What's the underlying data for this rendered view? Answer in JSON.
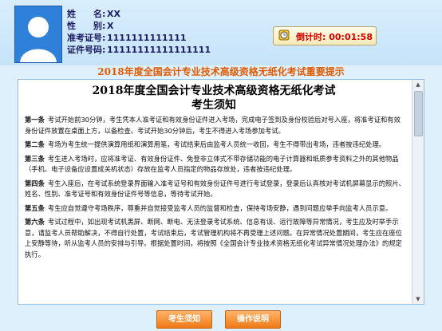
{
  "candidate": {
    "name_label": "姓　　名:",
    "name": "XX",
    "gender_label": "性　　别:",
    "gender": "X",
    "exam_no_label": "准考证号:",
    "exam_no": "1111111111111",
    "id_label": "证件号码:",
    "id_no": "11111111111111111"
  },
  "timer": {
    "label": "倒计时:",
    "value": "00:01:58",
    "icon": "clock-icon",
    "color": "#d10000"
  },
  "banner": "2018年度全国会计专业技术高级资格无纸化考试重要提示",
  "document": {
    "title": "2018年度全国会计专业技术高级资格无纸化考试",
    "subtitle": "考生须知",
    "articles": [
      {
        "label": "第一条",
        "text": "考试开始前30分钟，考生凭本人准考证和有效身份证件进入考场，完成电子签到及身份校验后对号入座，将准考证和有效身份证件放置在桌面上方，以备检查。考试开始30分钟后，考生不得进入考场参加考试。"
      },
      {
        "label": "第二条",
        "text": "考场为考生统一提供演算用纸和演算用笔，考试结束后由监考人员统一收回，考生不得带出考场，违者按违纪处理。"
      },
      {
        "label": "第三条",
        "text": "考生进入考场时，应将准考证、有效身份证件、免登非立体式不带存储功能的电子计算器和纸质参考资料之外的其他物品（手机、电子设备应设置成关机状态）存放在监考人员指定的物品存放处，违者按违纪处理。"
      },
      {
        "label": "第四条",
        "text": "考生入座后，在考试系统登录界面输入准考证号和有效身份证件号进行考试登录，登录后认真核对考试机屏幕显示的照片、姓名、性别、准考证号和有效身份证件号等信息，等待考试开始。"
      },
      {
        "label": "第五条",
        "text": "考生应自觉遵守考场秩序，尊重并自觉接受监考人员的监督和检查，保持考场安静，遇到问题应举手向监考人员示意。"
      },
      {
        "label": "第六条",
        "text": "考试过程中，如出现考试机黑屏、断网、断电、无法登录考试系统、信息有误、运行故障等异常情况，考生应及时举手示意，请监考人员帮助解决，不得自行处置，考试结束后，考试管理机构将不再受理上述问题。在异常情况处置期间，考生应在座位上安静等待，听从监考人员的安排与引导。根据处置时间，将按照《全国会计专业技术资格无纸化考试异常情况处理办法》的规定执行。"
      }
    ]
  },
  "buttons": {
    "notice": "考生须知",
    "instructions": "操作说明"
  },
  "colors": {
    "banner": "#e05a00",
    "button": "#ef7a16",
    "photo": "#2f80d8"
  }
}
